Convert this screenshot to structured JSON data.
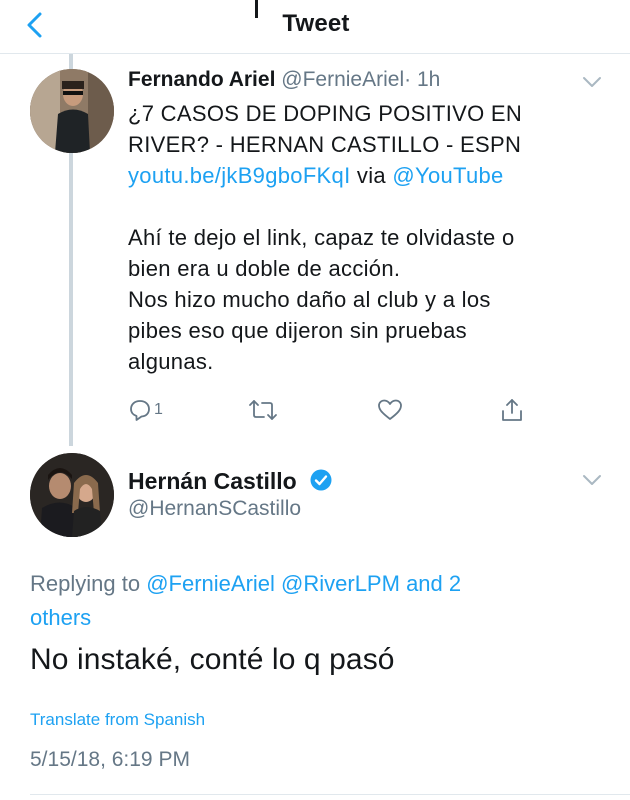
{
  "header": {
    "title": "Tweet"
  },
  "colors": {
    "accent": "#1da1f2",
    "secondary_text": "#657786",
    "thread_line": "#ccd6dd"
  },
  "parent_tweet": {
    "name": "Fernando Ariel",
    "handle": "@FernieAriel",
    "time": "· 1h",
    "text_line1": "¿7 CASOS DE DOPING POSITIVO EN",
    "text_line2": "RIVER? - HERNAN CASTILLO - ESPN",
    "link": "youtu.be/jkB9gboFKqI",
    "via": "via",
    "via_handle": "@YouTube",
    "body_line1": "Ahí te dejo el link, capaz te olvidaste o",
    "body_line2": "bien era u doble de acción.",
    "body_line3": "Nos hizo mucho daño al club y a los",
    "body_line4": "pibes eso que dijeron sin pruebas",
    "body_line5": "algunas.",
    "reply_count": "1",
    "icons": [
      "reply-icon",
      "retweet-icon",
      "like-icon",
      "share-icon"
    ]
  },
  "reply_tweet": {
    "name": "Hernán Castillo",
    "handle": "@HernanSCastillo",
    "replying_prefix": "Replying to",
    "mention1": "@FernieAriel",
    "mention2": "@RiverLPM",
    "and_others": "and 2",
    "others": "others",
    "text": "No instaké, conté lo q pasó",
    "translate": "Translate from Spanish",
    "date": "5/15/18, 6:19 PM"
  }
}
